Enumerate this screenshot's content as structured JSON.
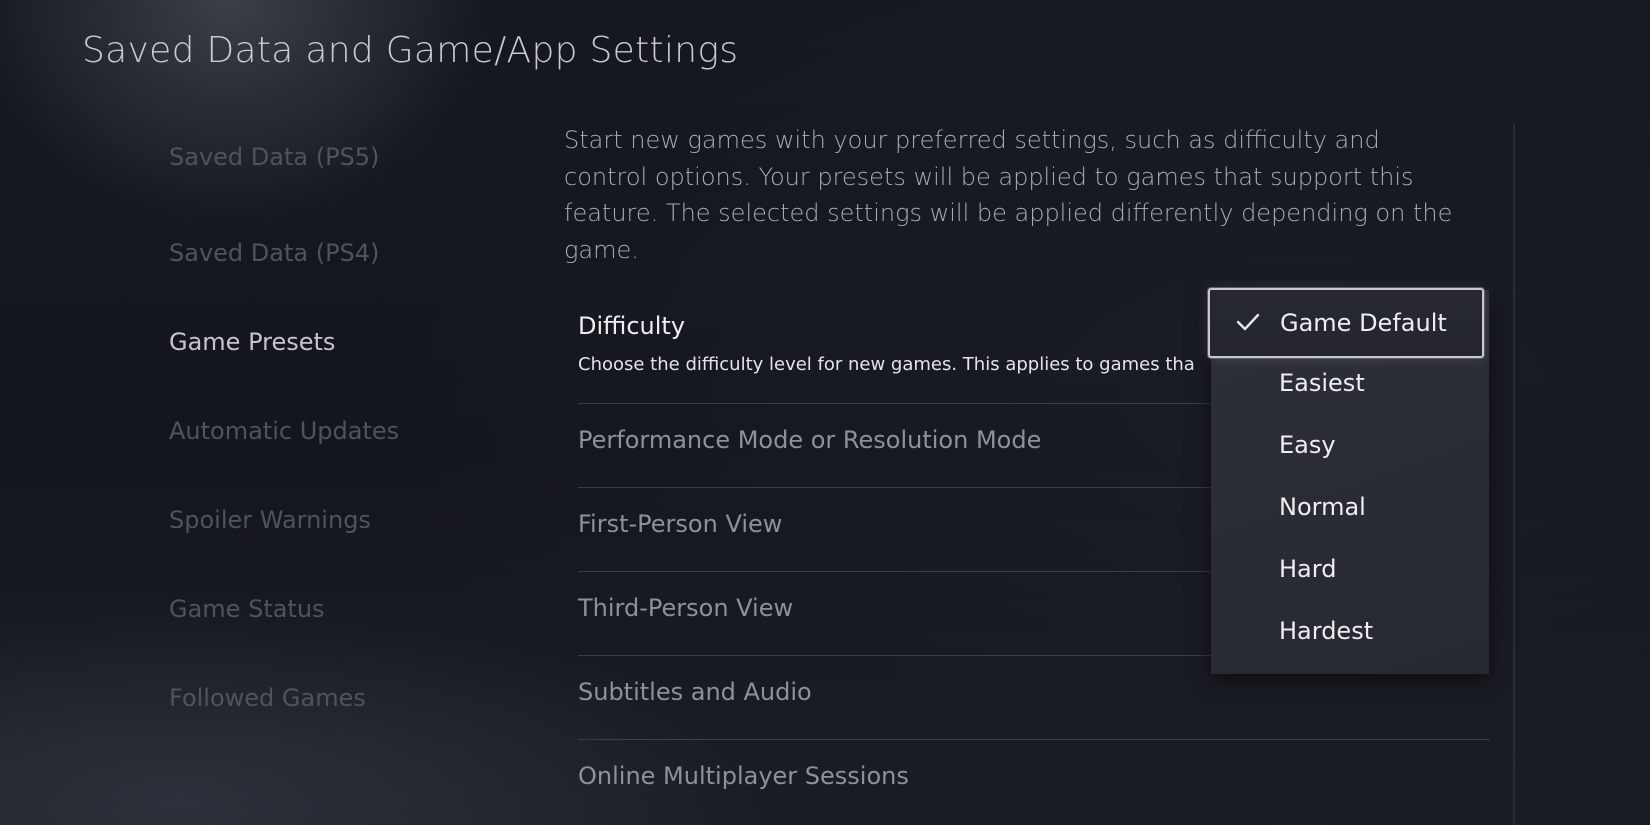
{
  "page_title": "Saved Data and Game/App Settings",
  "sidebar": {
    "items": [
      {
        "label": "Saved Data (PS5)",
        "active": false
      },
      {
        "label": "Saved Data (PS4)",
        "active": false
      },
      {
        "label": "Game Presets",
        "active": true
      },
      {
        "label": "Automatic Updates",
        "active": false
      },
      {
        "label": "Spoiler Warnings",
        "active": false
      },
      {
        "label": "Game Status",
        "active": false
      },
      {
        "label": "Followed Games",
        "active": false
      }
    ]
  },
  "main": {
    "description": "Start new games with your preferred settings, such as difficulty and control options. Your presets will be applied to games that support this feature. The selected settings will be applied differently depending on the game.",
    "settings": [
      {
        "label": "Difficulty",
        "description": "Choose the difficulty level for new games. This applies to games tha"
      },
      {
        "label": "Performance Mode or Resolution Mode"
      },
      {
        "label": "First-Person View"
      },
      {
        "label": "Third-Person View"
      },
      {
        "label": "Subtitles and Audio"
      },
      {
        "label": "Online Multiplayer Sessions"
      }
    ]
  },
  "dropdown": {
    "selected_value": "Game Default",
    "options": [
      "Game Default",
      "Easiest",
      "Easy",
      "Normal",
      "Hard",
      "Hardest"
    ]
  },
  "icons": {
    "selected_marker": "check-icon"
  }
}
